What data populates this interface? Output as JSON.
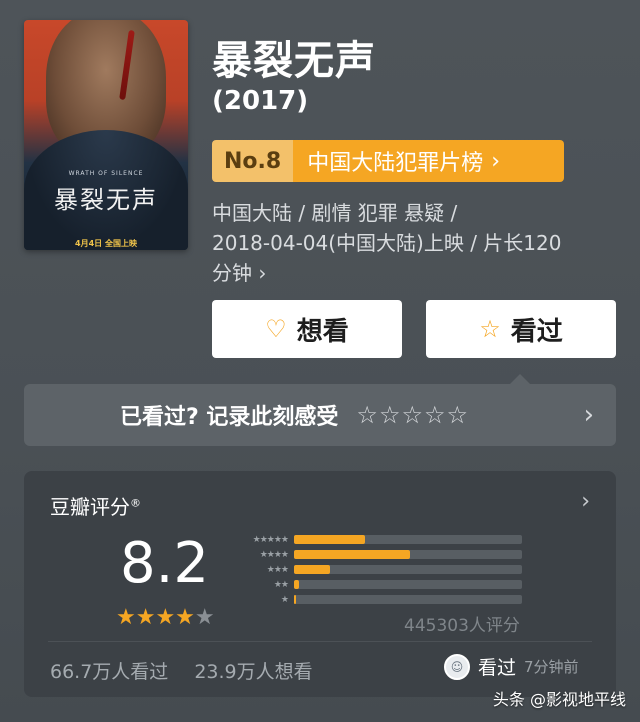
{
  "movie": {
    "title": "暴裂无声",
    "year": "(2017)",
    "rank_no": "No.8",
    "rank_list": "中国大陆犯罪片榜",
    "meta_line1": "中国大陆 / 剧情 犯罪 悬疑 /",
    "meta_line2": "2018-04-04(中国大陆)上映 / 片长120",
    "meta_line3": "分钟 ›"
  },
  "poster": {
    "title_text": "暴裂无声",
    "english": "WRATH OF SILENCE",
    "date_text": "4月4日 全国上映"
  },
  "actions": {
    "want_label": "想看",
    "seen_label": "看过"
  },
  "record": {
    "prompt": "已看过? 记录此刻感受",
    "stars": "☆☆☆☆☆"
  },
  "rating": {
    "header": "豆瓣评分",
    "registered": "®",
    "score": "8.2",
    "stars_on": "★★★★",
    "stars_off": "★",
    "count": "445303人评分",
    "distribution": [
      {
        "label": "★★★★★",
        "value": 0.31
      },
      {
        "label": "★★★★",
        "value": 0.51
      },
      {
        "label": "★★★",
        "value": 0.16
      },
      {
        "label": "★★",
        "value": 0.02
      },
      {
        "label": "★",
        "value": 0.01
      }
    ],
    "watched": "66.7万人看过",
    "wanted": "23.9万人想看",
    "user_seen": "看过",
    "user_time": "7分钟前"
  },
  "watermark": "头条 @影视地平线",
  "colors": {
    "accent": "#f5a623",
    "rank_badge": "#f3c16a",
    "card_bg": "#3c4146"
  }
}
